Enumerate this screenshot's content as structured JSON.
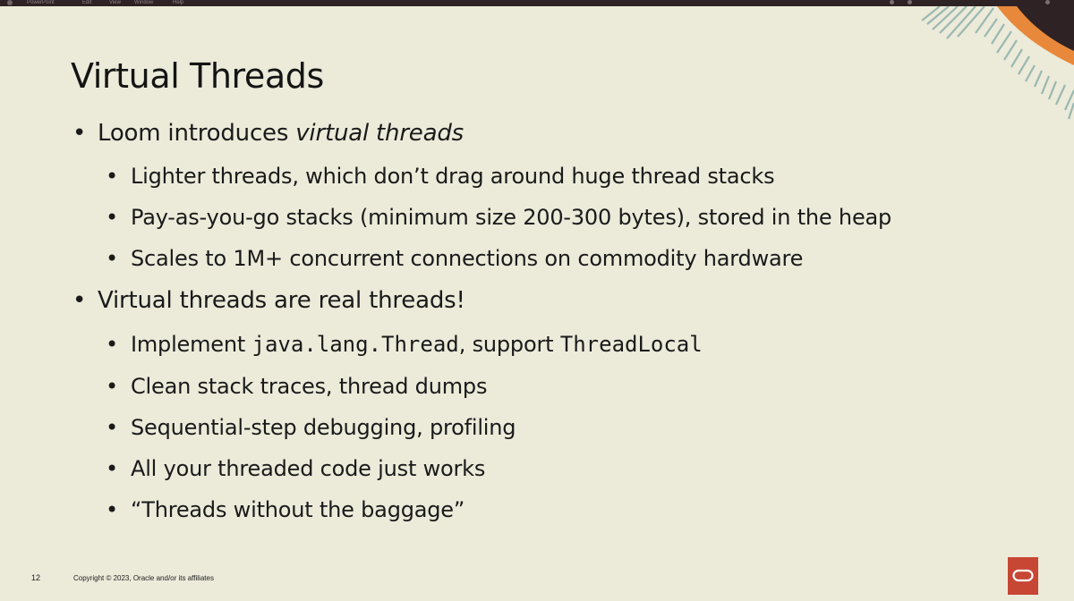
{
  "menubar": {
    "app_name": "PowerPoint",
    "items": [
      "Edit",
      "View",
      "Window",
      "Help"
    ]
  },
  "slide": {
    "title": "Virtual Threads",
    "bullets": [
      {
        "text_before": "Loom introduces ",
        "text_emphasis": "virtual threads",
        "children": [
          "Lighter threads, which don’t drag around huge thread stacks",
          "Pay-as-you-go stacks (minimum size 200-300 bytes), stored in the heap",
          "Scales to 1M+ concurrent connections on commodity hardware"
        ]
      },
      {
        "text": "Virtual threads are real threads!",
        "children": [
          {
            "prefix": "Implement ",
            "code1": "java.lang.Thread",
            "middle": ", support ",
            "code2": "ThreadLocal"
          },
          "Clean stack traces, thread dumps",
          "Sequential-step debugging, profiling",
          "All your threaded code just works",
          "“Threads without the baggage”"
        ]
      }
    ],
    "bullet_glyph": "•",
    "page_number": "12",
    "copyright": "Copyright © 2023, Oracle and/or its affiliates",
    "logo_icon": "oracle-logo-icon"
  },
  "colors": {
    "background": "#ecead9",
    "menubar": "#2e2224",
    "oracle_red": "#c74634",
    "accent_orange": "#e8883a"
  }
}
